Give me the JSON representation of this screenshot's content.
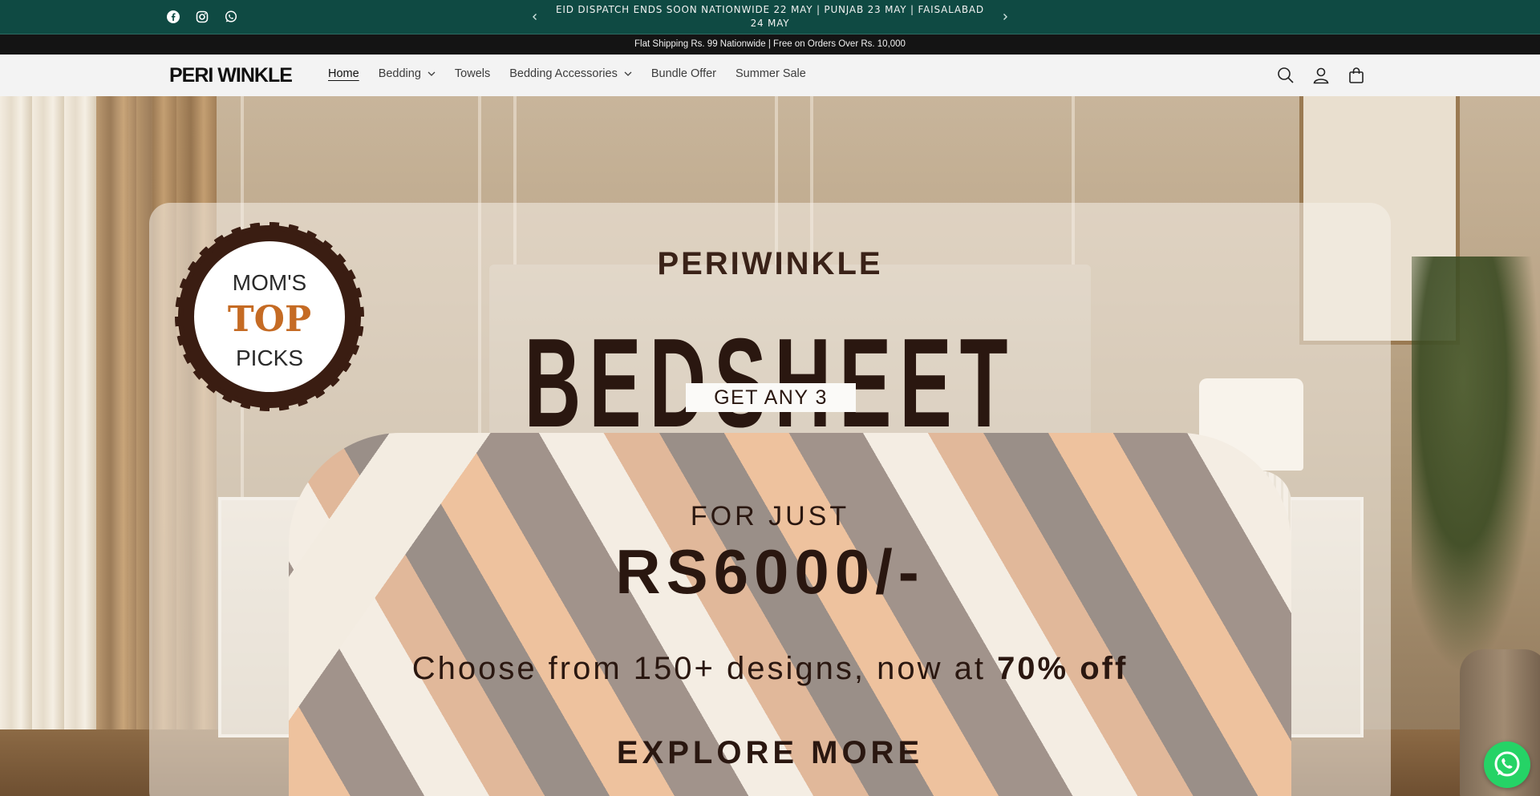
{
  "announcement": {
    "text": "EID DISPATCH ENDS SOON   NATIONWIDE 22 MAY | PUNJAB 23 MAY | FAISALABAD 24 MAY",
    "social_icons": [
      "facebook-icon",
      "instagram-icon",
      "whatsapp-icon"
    ],
    "background": "#0f4a43"
  },
  "shipping_bar": {
    "text": "Flat Shipping Rs. 99 Nationwide | Free on Orders Over Rs. 10,000"
  },
  "header": {
    "logo": "PERI WINKLE",
    "nav": [
      {
        "label": "Home",
        "active": true,
        "dropdown": false
      },
      {
        "label": "Bedding",
        "active": false,
        "dropdown": true
      },
      {
        "label": "Towels",
        "active": false,
        "dropdown": false
      },
      {
        "label": "Bedding Accessories",
        "active": false,
        "dropdown": true
      },
      {
        "label": "Bundle Offer",
        "active": false,
        "dropdown": false
      },
      {
        "label": "Summer Sale",
        "active": false,
        "dropdown": false
      }
    ],
    "icons": [
      "search-icon",
      "account-icon",
      "cart-icon"
    ]
  },
  "hero": {
    "badge": {
      "line1": "MOM'S",
      "line2": "TOP",
      "line3": "PICKS"
    },
    "brand": "PERIWINKLE",
    "headline": "BEDSHEET",
    "tag": "GET ANY 3",
    "for_just": "FOR JUST",
    "price": "RS6000/-",
    "choose_prefix": "Choose from 150+ designs, now at ",
    "choose_bold": "70% off",
    "cta": "EXPLORE MORE"
  },
  "colors": {
    "accent": "#0f4a43",
    "badge_orange": "#c56b24",
    "hero_text": "#2a1710",
    "whatsapp": "#25d366"
  }
}
